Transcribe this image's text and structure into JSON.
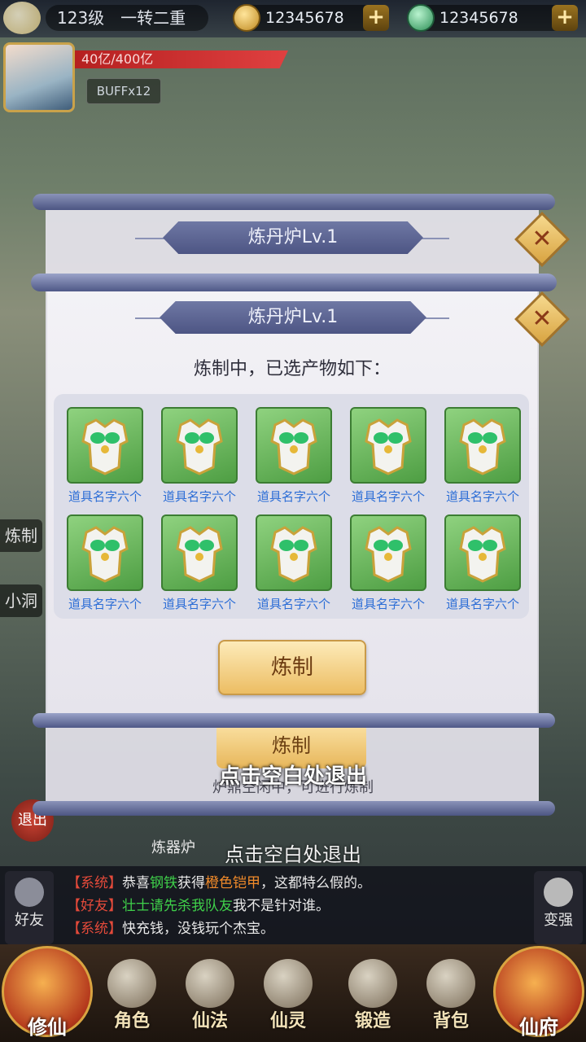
{
  "hud": {
    "level_text": "123级　一转二重",
    "gold_value": "12345678",
    "jade_value": "12345678",
    "hp_text": "40亿/400亿",
    "buff_text": "BUFFx12"
  },
  "side": {
    "label_1": "炼制",
    "label_2": "小洞",
    "exit_label": "退出"
  },
  "back_panel": {
    "title": "炼丹炉Lv.1",
    "button_label": "炼制",
    "tip": "炉鼎空闲中，可进行炼制",
    "exit_tip": "点击空白处退出",
    "furnace_label": "炼器炉"
  },
  "dialog": {
    "title": "炼丹炉Lv.1",
    "subtitle": "炼制中，已选产物如下：",
    "items": [
      {
        "name": "道具名字六个",
        "icon": "armor-icon"
      },
      {
        "name": "道具名字六个",
        "icon": "armor-icon"
      },
      {
        "name": "道具名字六个",
        "icon": "armor-icon"
      },
      {
        "name": "道具名字六个",
        "icon": "armor-icon"
      },
      {
        "name": "道具名字六个",
        "icon": "armor-icon"
      },
      {
        "name": "道具名字六个",
        "icon": "armor-icon"
      },
      {
        "name": "道具名字六个",
        "icon": "armor-icon"
      },
      {
        "name": "道具名字六个",
        "icon": "armor-icon"
      },
      {
        "name": "道具名字六个",
        "icon": "armor-icon"
      },
      {
        "name": "道具名字六个",
        "icon": "armor-icon"
      }
    ],
    "craft_label": "炼制",
    "exit_tip": "点击空白处退出"
  },
  "chat": {
    "lines": [
      {
        "tag": "【系统】",
        "a": "恭喜",
        "name": "钢铁",
        "b": "获得",
        "item": "橙色铠甲",
        "c": "，这都特么假的。"
      },
      {
        "tag": "【好友】",
        "name": "壮士请先杀我队友",
        "c": "我不是针对谁。"
      },
      {
        "tag": "【系统】",
        "c": "快充钱，没钱玩个杰宝。"
      }
    ],
    "friend_label": "好友",
    "strong_label": "变强"
  },
  "nav": {
    "xiuxian": "修仙",
    "juese": "角色",
    "xianfa": "仙法",
    "xianling": "仙灵",
    "duanzao": "锻造",
    "beibao": "背包",
    "xianfu": "仙府"
  },
  "colors": {
    "item_name": "#2d6ed6",
    "banner": "#4d5584",
    "button": "#ecbd63",
    "system_tag": "#e44a3a"
  }
}
